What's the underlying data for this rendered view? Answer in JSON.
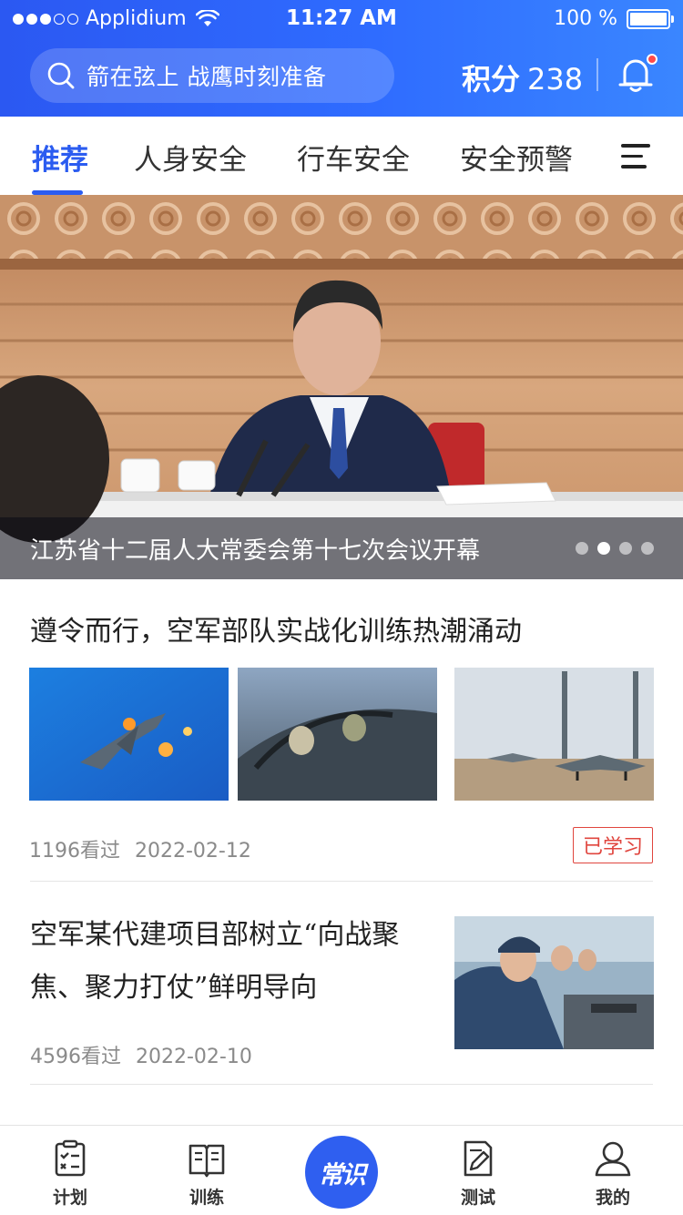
{
  "status_bar": {
    "carrier": "Applidium",
    "time": "11:27 AM",
    "battery": "100 %",
    "battery_level": 1.0,
    "signal_bars": 3
  },
  "header": {
    "search_text": "箭在弦上 战鹰时刻准备",
    "points_label": "积分",
    "points_value": "238",
    "has_notification": true,
    "colors": {
      "gradient_start": "#2b58f2",
      "gradient_end": "#3a86ff"
    }
  },
  "tabs": [
    {
      "label": "推荐",
      "active": true
    },
    {
      "label": "人身安全",
      "active": false
    },
    {
      "label": "行车安全",
      "active": false
    },
    {
      "label": "安全预警",
      "active": false
    }
  ],
  "banner": {
    "caption": "江苏省十二届人大常委会第十七次会议开幕",
    "slide_count": 4,
    "active_slide": 2
  },
  "articles": [
    {
      "title": "遵令而行，空军部队实战化训练热潮涌动",
      "views": "1196看过",
      "date": "2022-02-12",
      "badge": "已学习"
    },
    {
      "title": "空军某代建项目部树立“向战聚焦、聚力打仗”鲜明导向",
      "views": "4596看过",
      "date": "2022-02-10"
    }
  ],
  "bottom_nav": {
    "items": [
      {
        "label": "计划",
        "icon": "checklist-icon"
      },
      {
        "label": "训练",
        "icon": "book-icon"
      },
      {
        "label": "测试",
        "icon": "edit-document-icon"
      },
      {
        "label": "我的",
        "icon": "user-icon"
      }
    ],
    "center_label": "常识",
    "accent": "#2f5ff0"
  }
}
